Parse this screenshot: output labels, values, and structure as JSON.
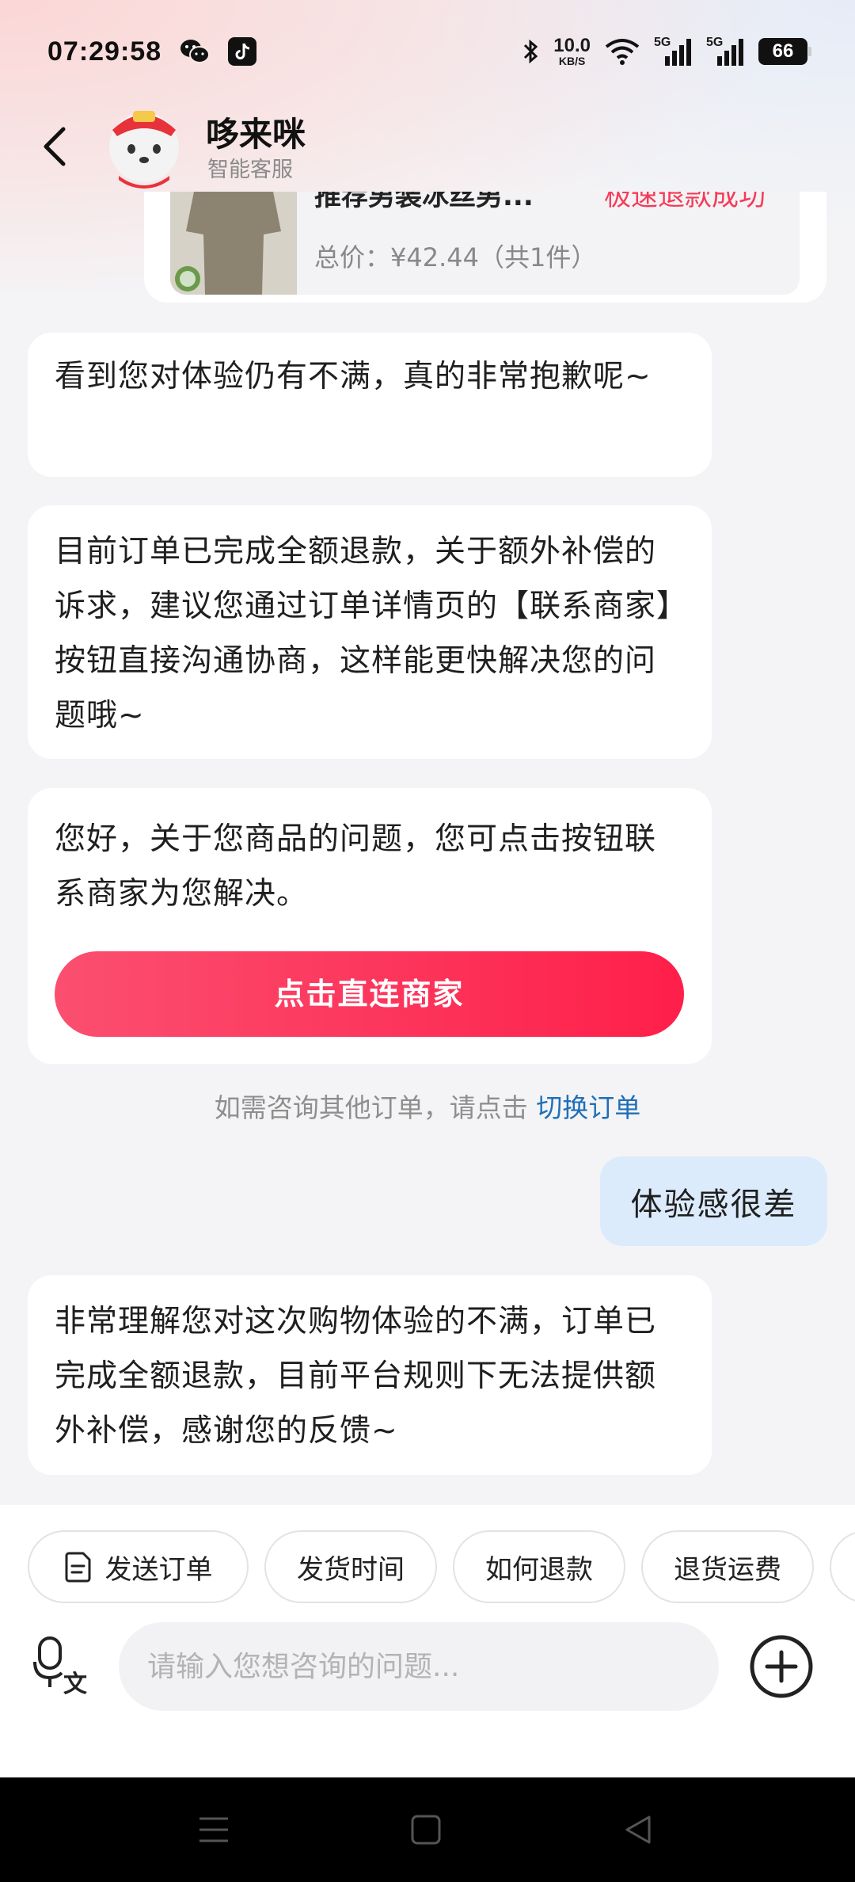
{
  "status_bar": {
    "time": "07:29:58",
    "net_speed_value": "10.0",
    "net_speed_unit": "KB/S",
    "signal1_label": "5G",
    "signal2_label": "5G",
    "battery": "66"
  },
  "header": {
    "brand_name": "哆来咪",
    "subtitle": "智能客服"
  },
  "order_card": {
    "title": "推荐男装冰丝男...",
    "status": "极速退款成功",
    "price": "总价：¥42.44（共1件）"
  },
  "messages": {
    "m1": "看到您对体验仍有不满，真的非常抱歉呢~",
    "m2": "目前订单已完成全额退款，关于额外补偿的诉求，建议您通过订单详情页的【联系商家】按钮直接沟通协商，这样能更快解决您的问题哦~",
    "m3": "您好，关于您商品的问题，您可点击按钮联系商家为您解决。",
    "m3_button": "点击直连商家",
    "hint_text": "如需咨询其他订单，请点击",
    "hint_link": "切换订单",
    "user_msg": "体验感很差",
    "m5": "非常理解您对这次购物体验的不满，订单已完成全额退款，目前平台规则下无法提供额外补偿，感谢您的反馈~"
  },
  "quick_actions": [
    {
      "label": "发送订单",
      "icon": "document-icon"
    },
    {
      "label": "发货时间"
    },
    {
      "label": "如何退款"
    },
    {
      "label": "退货运费"
    }
  ],
  "input": {
    "placeholder": "请输入您想咨询的问题..."
  },
  "colors": {
    "accent": "#fe1f4a",
    "link": "#1f6fb8",
    "user_bubble": "#dcebfb",
    "refund_status": "#f53b57"
  }
}
